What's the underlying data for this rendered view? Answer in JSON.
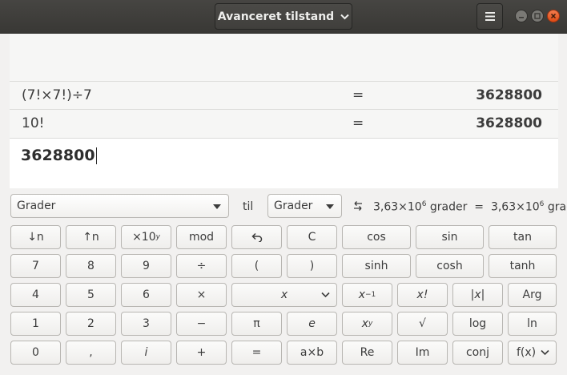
{
  "header": {
    "mode_label": "Avanceret tilstand"
  },
  "history": [
    {
      "expression": "(7!×7!)÷7",
      "equals": "=",
      "result": "3628800"
    },
    {
      "expression": "10!",
      "equals": "=",
      "result": "3628800"
    }
  ],
  "entry": {
    "value": "3628800"
  },
  "conversion": {
    "from_unit": "Grader",
    "to_label": "til",
    "to_unit": "Grader",
    "from_mantissa": "3,63×10",
    "from_exponent": "6",
    "from_unit_word": "grader",
    "equals": "=",
    "to_mantissa": "3,63×10",
    "to_exponent": "6",
    "to_unit_word": "grader"
  },
  "keypad": {
    "row1": {
      "down_n": "↓n",
      "up_n": "↑n",
      "times10_base": "×10",
      "times10_exp": "y",
      "mod": "mod",
      "clear": "C",
      "cos": "cos",
      "sin": "sin",
      "tan": "tan"
    },
    "row2": {
      "seven": "7",
      "eight": "8",
      "nine": "9",
      "divide": "÷",
      "open_paren": "(",
      "close_paren": ")",
      "sinh": "sinh",
      "cosh": "cosh",
      "tanh": "tanh"
    },
    "row3": {
      "four": "4",
      "five": "5",
      "six": "6",
      "multiply": "×",
      "variable_x": "x",
      "inverse_base": "x",
      "inverse_exp": "−1",
      "factorial": "x!",
      "abs": "|x|",
      "arg": "Arg"
    },
    "row4": {
      "one": "1",
      "two": "2",
      "three": "3",
      "minus": "−",
      "pi": "π",
      "e": "e",
      "power_base": "x",
      "power_exp": "y",
      "sqrt": "√",
      "log": "log",
      "ln": "ln"
    },
    "row5": {
      "zero": "0",
      "decimal": ",",
      "imaginary": "i",
      "plus": "+",
      "equals": "=",
      "multiply_ab": "a×b",
      "re": "Re",
      "im": "Im",
      "conj": "conj",
      "fx": "f(x)"
    }
  }
}
